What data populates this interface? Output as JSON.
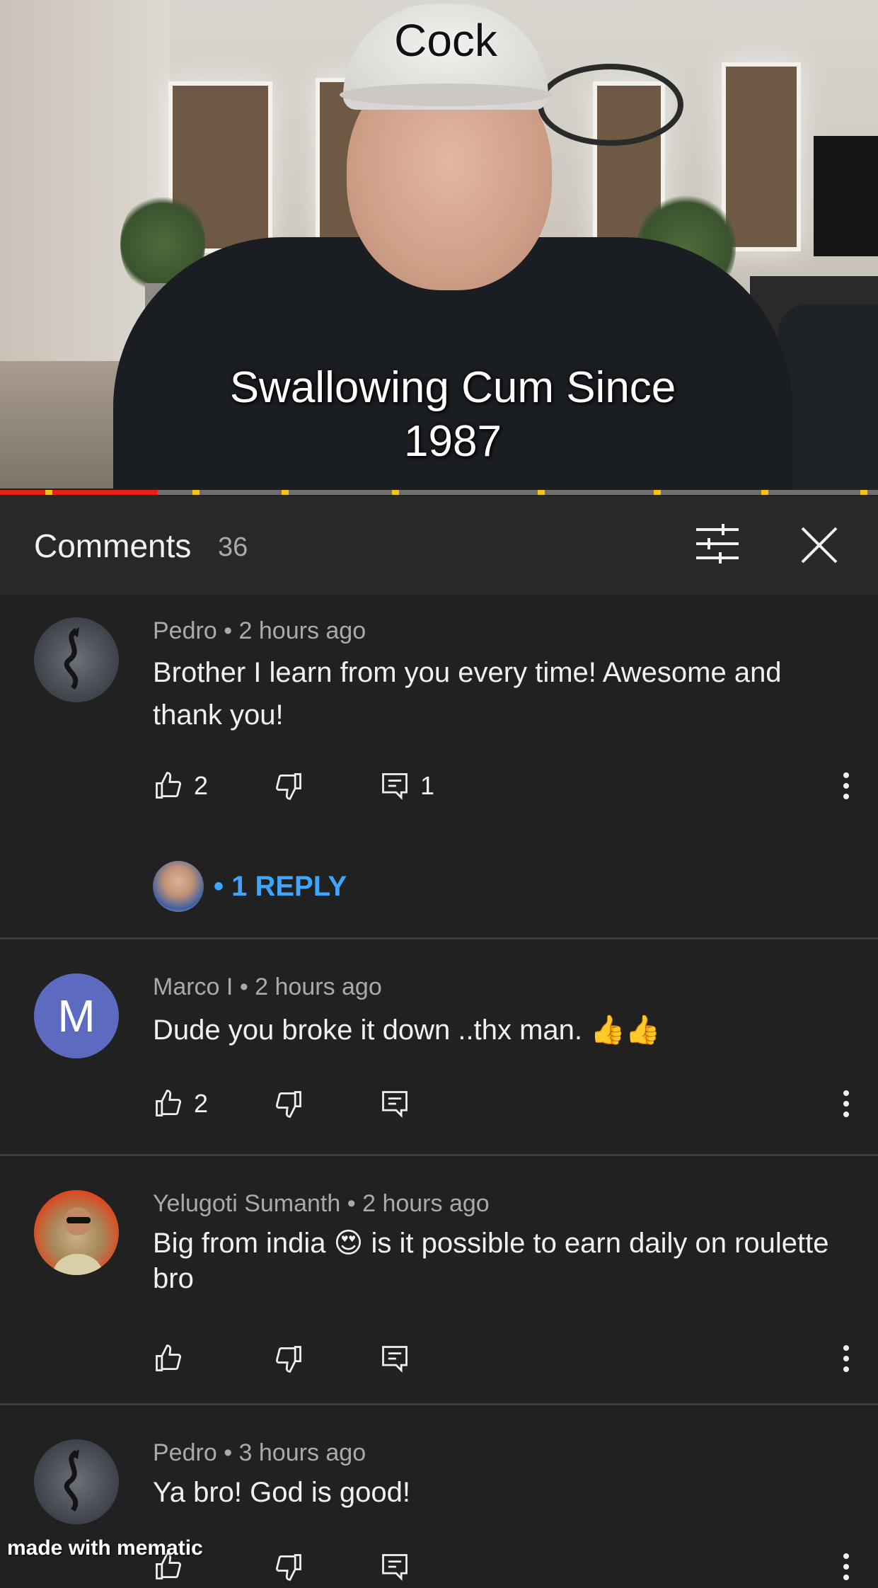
{
  "video": {
    "cap_text": "Cock",
    "caption_line1": "Swallowing Cum Since",
    "caption_line2": "1987",
    "progress_fraction": 0.18
  },
  "comments_panel": {
    "title": "Comments",
    "count": "36"
  },
  "comments": [
    {
      "author": "Pedro",
      "time": "2 hours ago",
      "text": "Brother I learn from you every time! Awesome and thank you!",
      "likes": "2",
      "replies_count": "1",
      "reply_link": "• 1 REPLY"
    },
    {
      "author": "Marco I",
      "avatar_letter": "M",
      "time": "2 hours ago",
      "text": "Dude you broke it down ..thx man. 👍👍",
      "likes": "2"
    },
    {
      "author": "Yelugoti Sumanth",
      "time": "2 hours ago",
      "text": "Big from india 😍 is it possible to earn daily on roulette bro"
    },
    {
      "author": "Pedro",
      "time": "3 hours ago",
      "text": "Ya bro! God is good!"
    }
  ],
  "separator": "•",
  "watermark": "made with mematic",
  "colors": {
    "background": "#212121",
    "header": "#282828",
    "link": "#3ea6ff",
    "progress": "#e62117",
    "chapter_marker": "#f4c21a"
  }
}
